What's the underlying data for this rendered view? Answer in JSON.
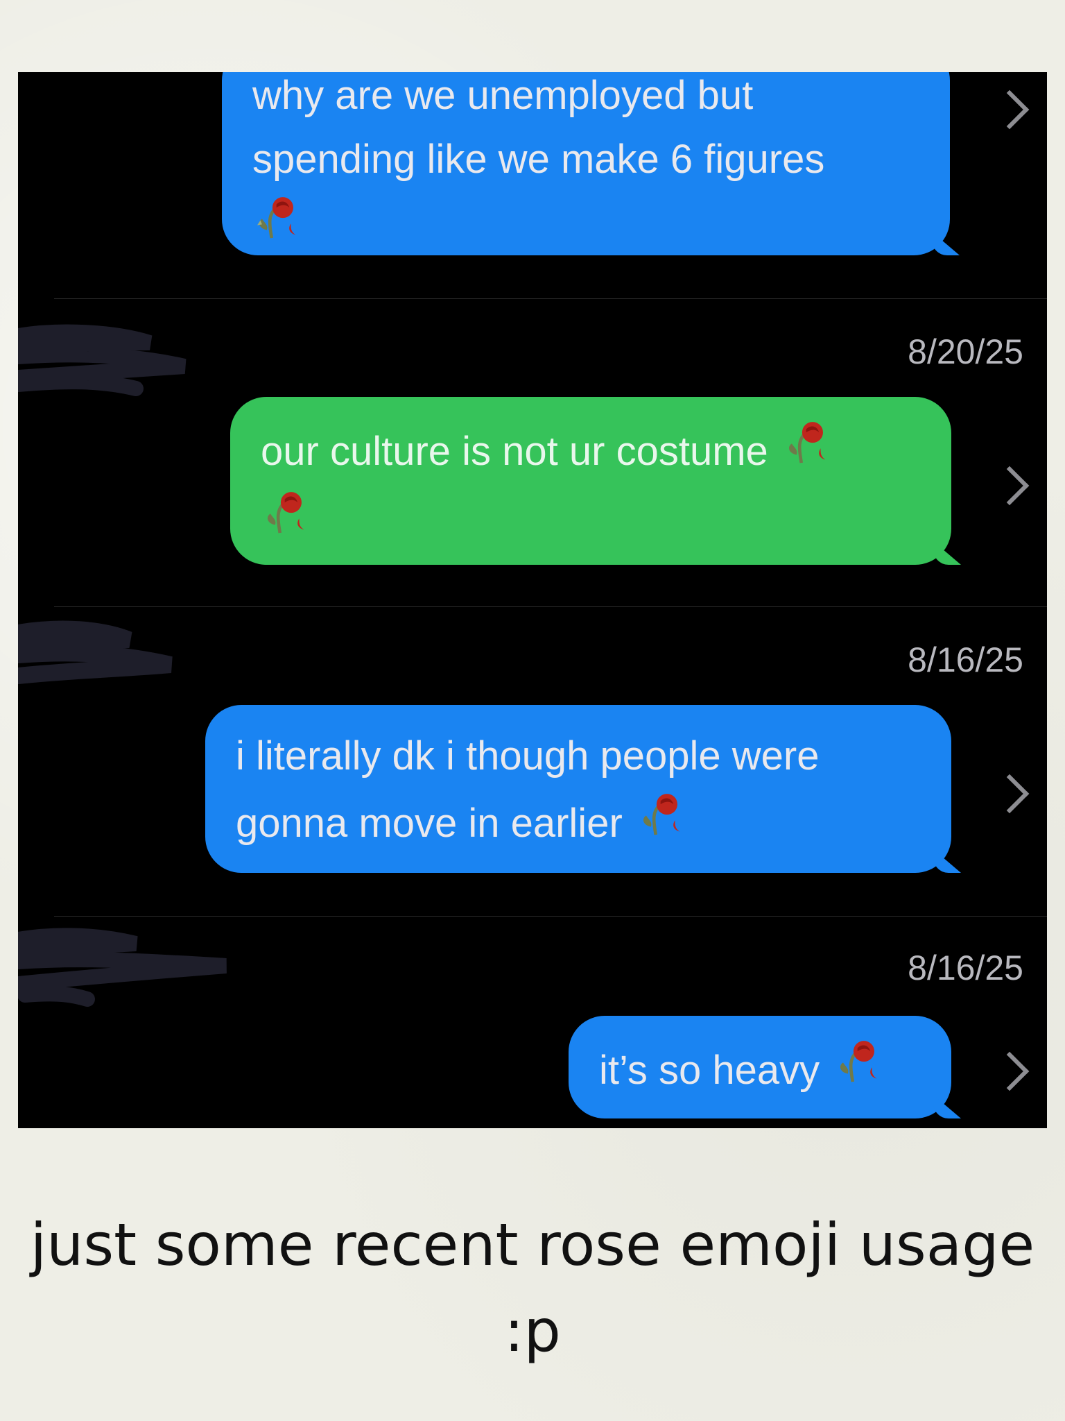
{
  "messages": [
    {
      "line1": "why are we unemployed but",
      "line2": "spending like we make 6 figures",
      "color": "blue"
    },
    {
      "text": "our culture is not ur costume",
      "color": "green",
      "date": "8/20/25"
    },
    {
      "line1": "i literally dk i though people were",
      "line2": "gonna move in earlier",
      "color": "blue",
      "date": "8/16/25"
    },
    {
      "text": "it’s so heavy",
      "color": "blue",
      "date": "8/16/25"
    }
  ],
  "icons": {
    "chevron": "chevron-right-icon",
    "rose": "wilted-rose-icon"
  },
  "colors": {
    "blue_bubble": "#1a84f2",
    "green_bubble": "#36c35a",
    "background": "#000000"
  },
  "caption": {
    "line1": "just some recent rose emoji usage",
    "line2": ":p"
  }
}
